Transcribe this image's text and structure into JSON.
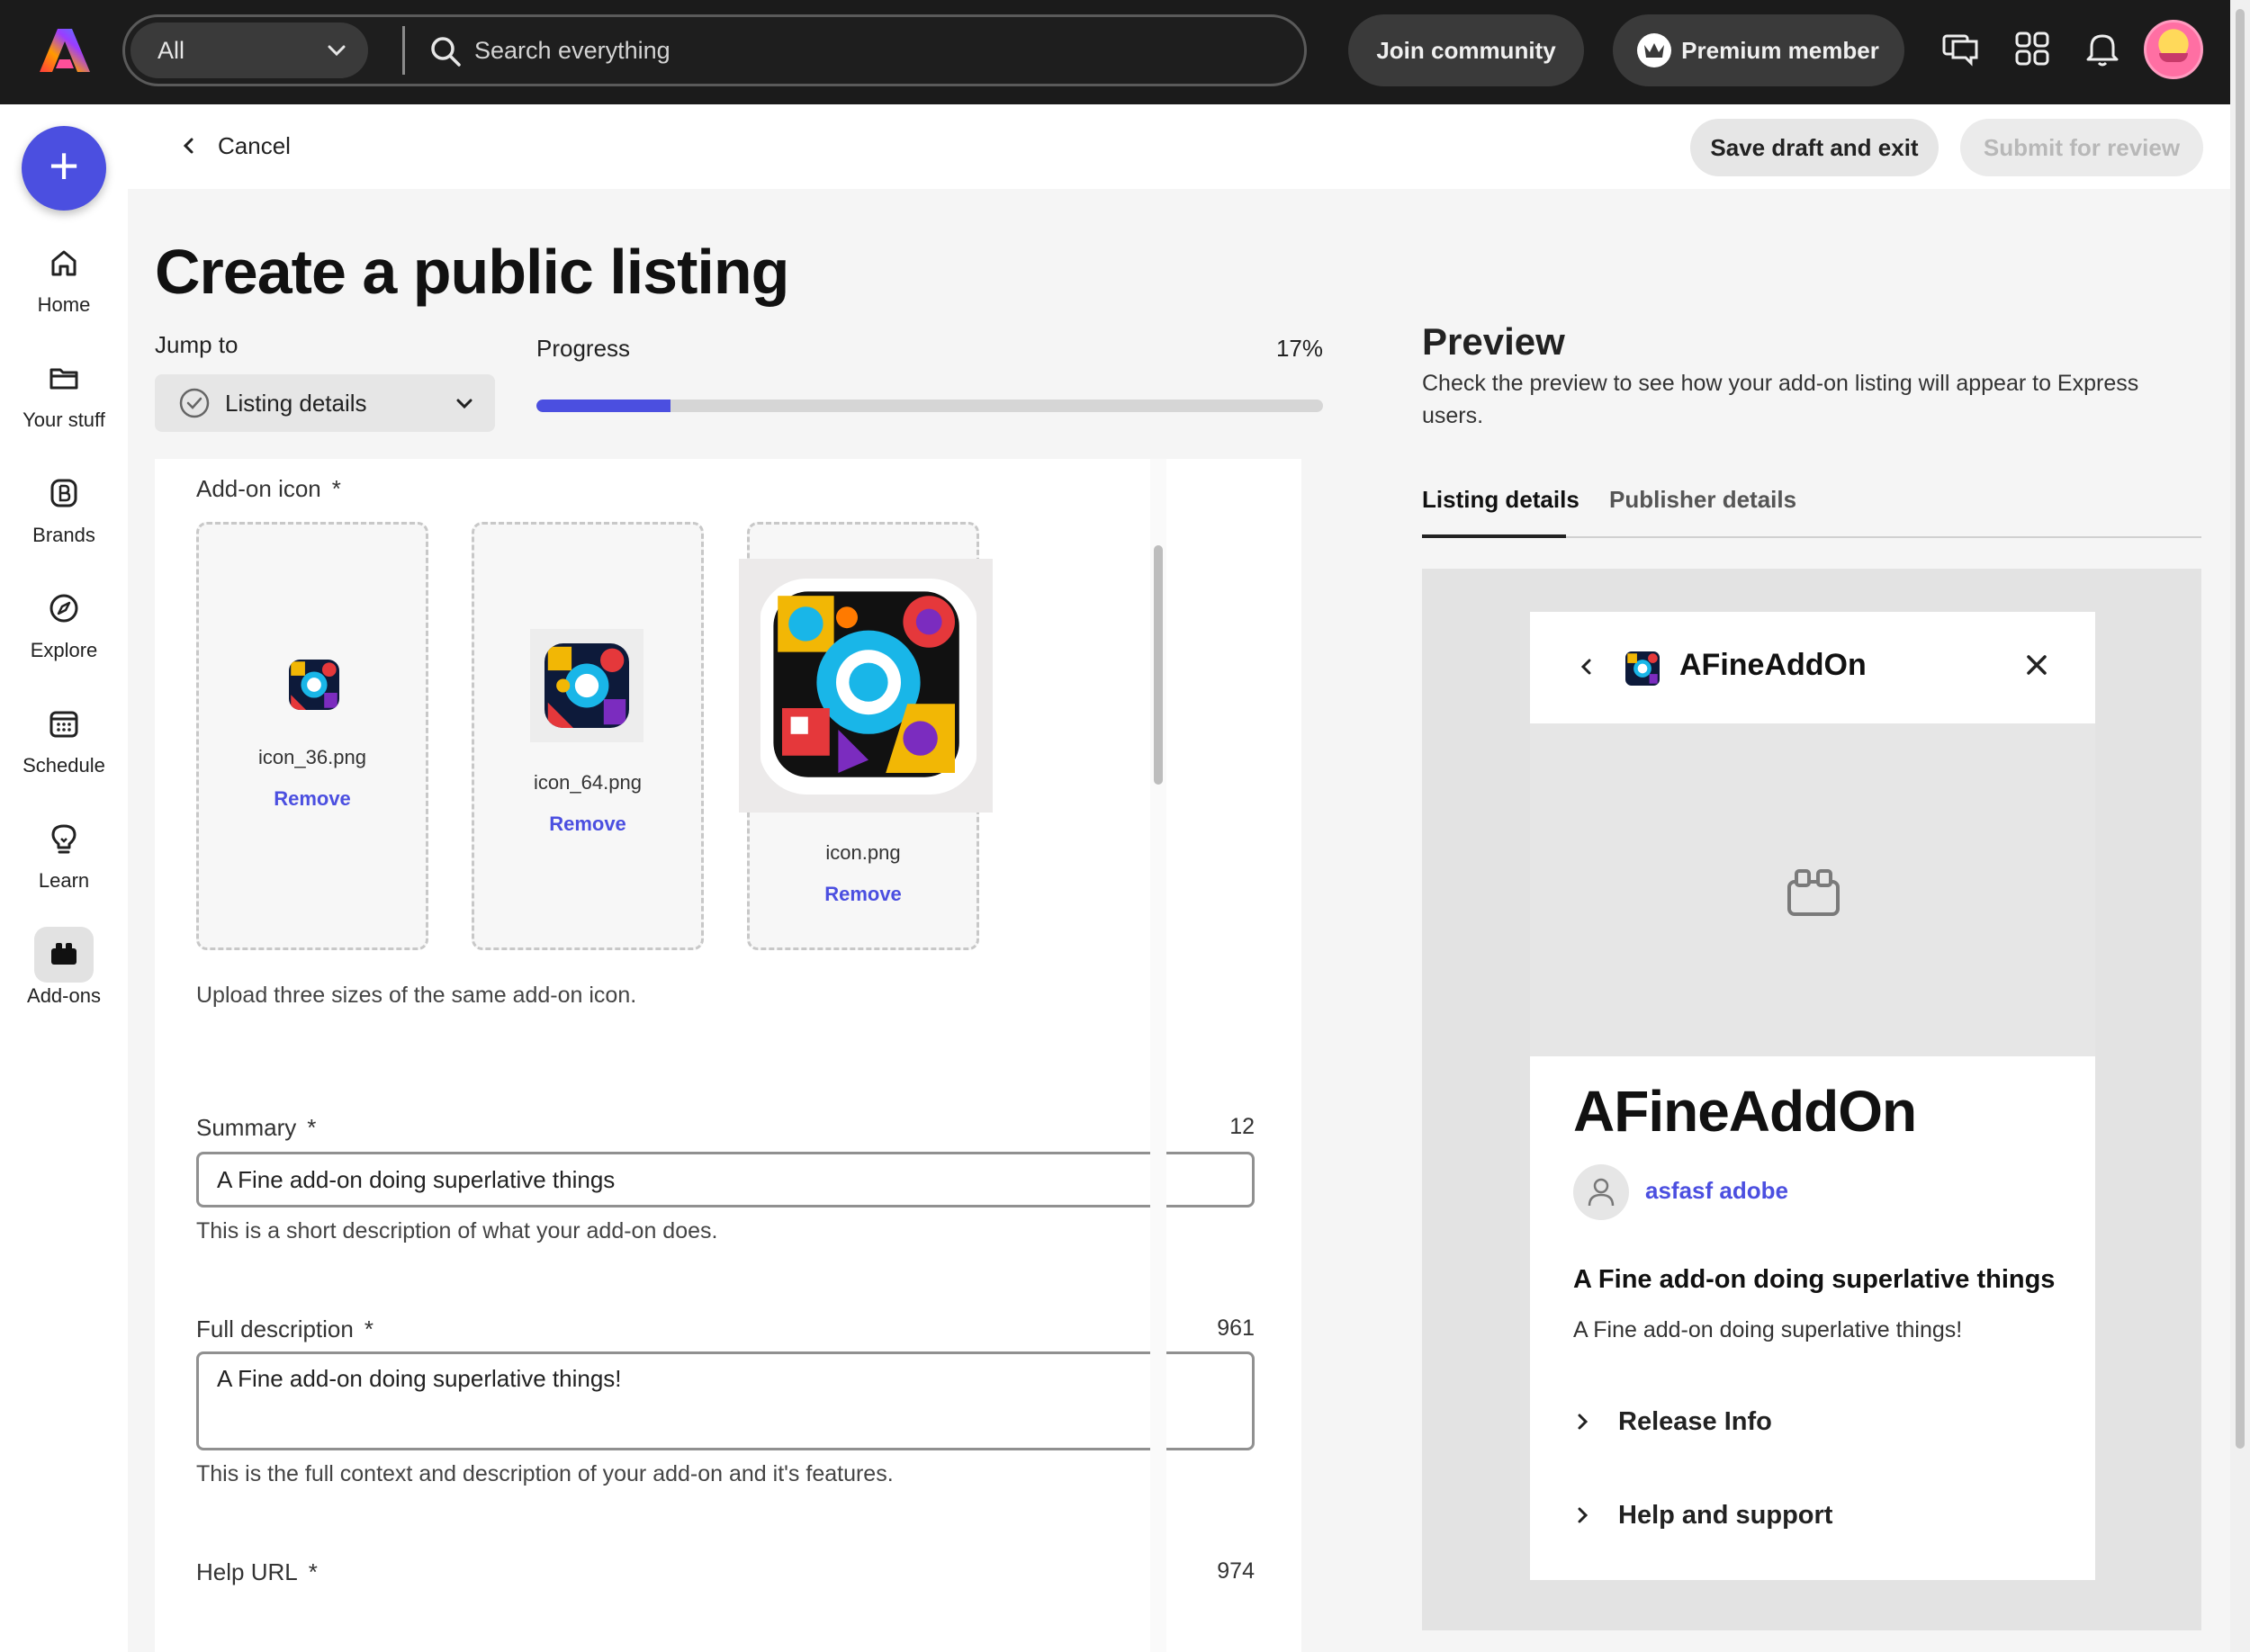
{
  "topbar": {
    "search_scope": "All",
    "search_placeholder": "Search everything",
    "join_label": "Join community",
    "premium_label": "Premium member"
  },
  "rail": {
    "items": [
      {
        "label": "Home",
        "icon": "home-icon"
      },
      {
        "label": "Your stuff",
        "icon": "folder-icon"
      },
      {
        "label": "Brands",
        "icon": "brand-icon"
      },
      {
        "label": "Explore",
        "icon": "compass-icon"
      },
      {
        "label": "Schedule",
        "icon": "calendar-icon"
      },
      {
        "label": "Learn",
        "icon": "lightbulb-icon"
      },
      {
        "label": "Add-ons",
        "icon": "addons-icon",
        "active": true
      }
    ]
  },
  "subheader": {
    "cancel_label": "Cancel",
    "save_label": "Save draft and exit",
    "submit_label": "Submit for review"
  },
  "main": {
    "title": "Create a public listing",
    "jump_label": "Jump to",
    "jump_value": "Listing details",
    "progress_label": "Progress",
    "progress_text": "17%",
    "progress_fraction": 0.17
  },
  "form": {
    "addon_icon_label": "Add-on icon",
    "required_mark": "*",
    "icons": [
      {
        "file": "icon_36.png",
        "remove": "Remove"
      },
      {
        "file": "icon_64.png",
        "remove": "Remove"
      },
      {
        "file": "icon.png",
        "remove": "Remove"
      }
    ],
    "icon_helper": "Upload three sizes of the same add-on icon.",
    "summary_label": "Summary",
    "summary_count": "12",
    "summary_value": "A Fine add-on doing superlative things",
    "summary_helper": "This is a short description of what your add-on does.",
    "full_desc_label": "Full description",
    "full_desc_count": "961",
    "full_desc_value": "A Fine add-on doing superlative things!",
    "full_desc_helper": "This is the full context and description of your add-on and it's features.",
    "help_url_label": "Help URL",
    "help_url_count": "974"
  },
  "preview": {
    "title": "Preview",
    "description": "Check the preview to see how your add-on listing will appear to Express users.",
    "tabs": [
      "Listing details",
      "Publisher details"
    ],
    "app_name": "AFineAddOn",
    "author": "asfasf adobe",
    "summary": "A Fine add-on doing superlative things",
    "desc": "A Fine add-on doing superlative things!",
    "accordion": [
      "Release Info",
      "Help and support"
    ]
  },
  "colors": {
    "accent": "#4b4fe0",
    "topbar": "#1b1b1b"
  }
}
